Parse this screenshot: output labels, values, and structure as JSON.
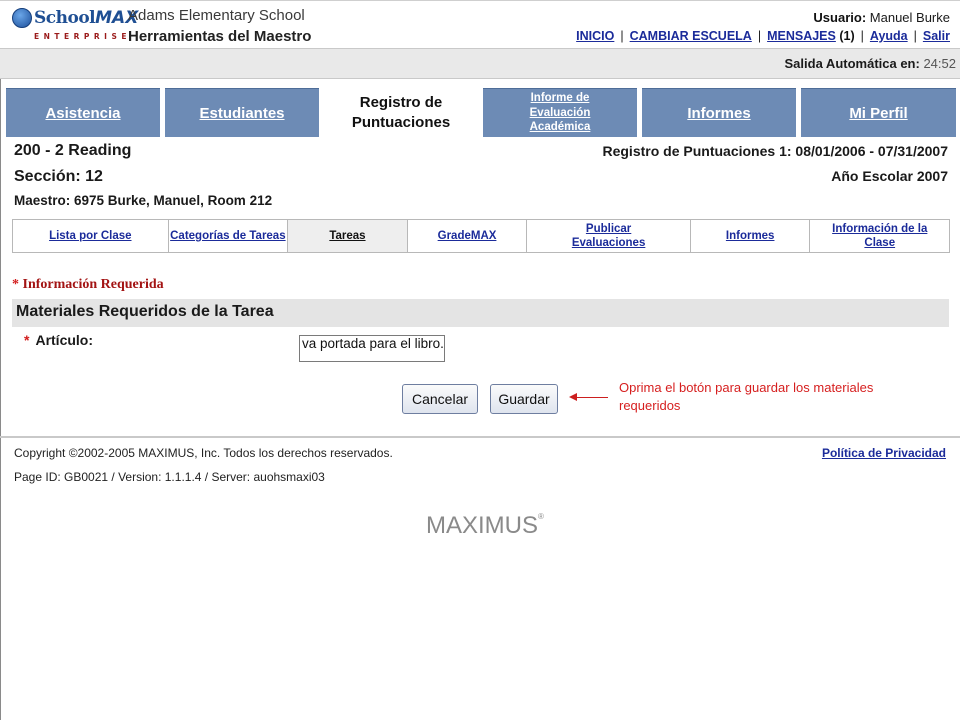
{
  "header": {
    "logo_school": "School",
    "logo_max": "MAX",
    "logo_enterprise": "ENTERPRISE",
    "school_name": "Adams Elementary School",
    "tool_name": "Herramientas del Maestro",
    "user_label": "Usuario:",
    "user_name": "Manuel Burke",
    "nav": {
      "inicio": "INICIO",
      "cambiar_escuela": "CAMBIAR ESCUELA",
      "mensajes": "MENSAJES",
      "mensajes_count": "(1)",
      "ayuda": "Ayuda",
      "salir": "Salir"
    }
  },
  "logout": {
    "label": "Salida Automática en:",
    "time": "24:52"
  },
  "tabs": [
    {
      "label": "Asistencia"
    },
    {
      "label": "Estudiantes"
    },
    {
      "label": "Registro de Puntuaciones"
    },
    {
      "label": "Informe de Evaluación Académica"
    },
    {
      "label": "Informes"
    },
    {
      "label": "Mi Perfil"
    }
  ],
  "course": {
    "title": "200 - 2 Reading",
    "section": "Sección: 12",
    "teacher": "Maestro: 6975 Burke, Manuel, Room 212",
    "period": "Registro de Puntuaciones 1: 08/01/2006 - 07/31/2007",
    "year": "Año Escolar 2007"
  },
  "subnav": [
    {
      "label": "Lista por Clase"
    },
    {
      "label": "Categorías de Tareas"
    },
    {
      "label": "Tareas"
    },
    {
      "label": "GradeMAX"
    },
    {
      "label": "Publicar Evaluaciones"
    },
    {
      "label": "Informes"
    },
    {
      "label": "Información de la Clase"
    }
  ],
  "form": {
    "required_star": "*",
    "required_info": "Información Requerida",
    "section_title": "Materiales Requeridos de la Tarea",
    "field_label": "Artículo:",
    "field_value": "va portada para el libro.",
    "cancel_label": "Cancelar",
    "save_label": "Guardar"
  },
  "callout": {
    "text": "Oprima el botón para guardar los materiales requeridos",
    "color": "#d61f1f"
  },
  "footer": {
    "copyright": "Copyright ©2002-2005 MAXIMUS, Inc. Todos los derechos reservados.",
    "privacy": "Política de Privacidad",
    "page_id": "Page ID: GB0021 / Version: 1.1.1.4 / Server: auohsmaxi03",
    "brand": "MAXIMUS",
    "brand_mark": "®"
  },
  "colors": {
    "tab_blue": "#6d8bb5",
    "link_blue": "#1b2b9a",
    "required_red": "#a31414"
  }
}
